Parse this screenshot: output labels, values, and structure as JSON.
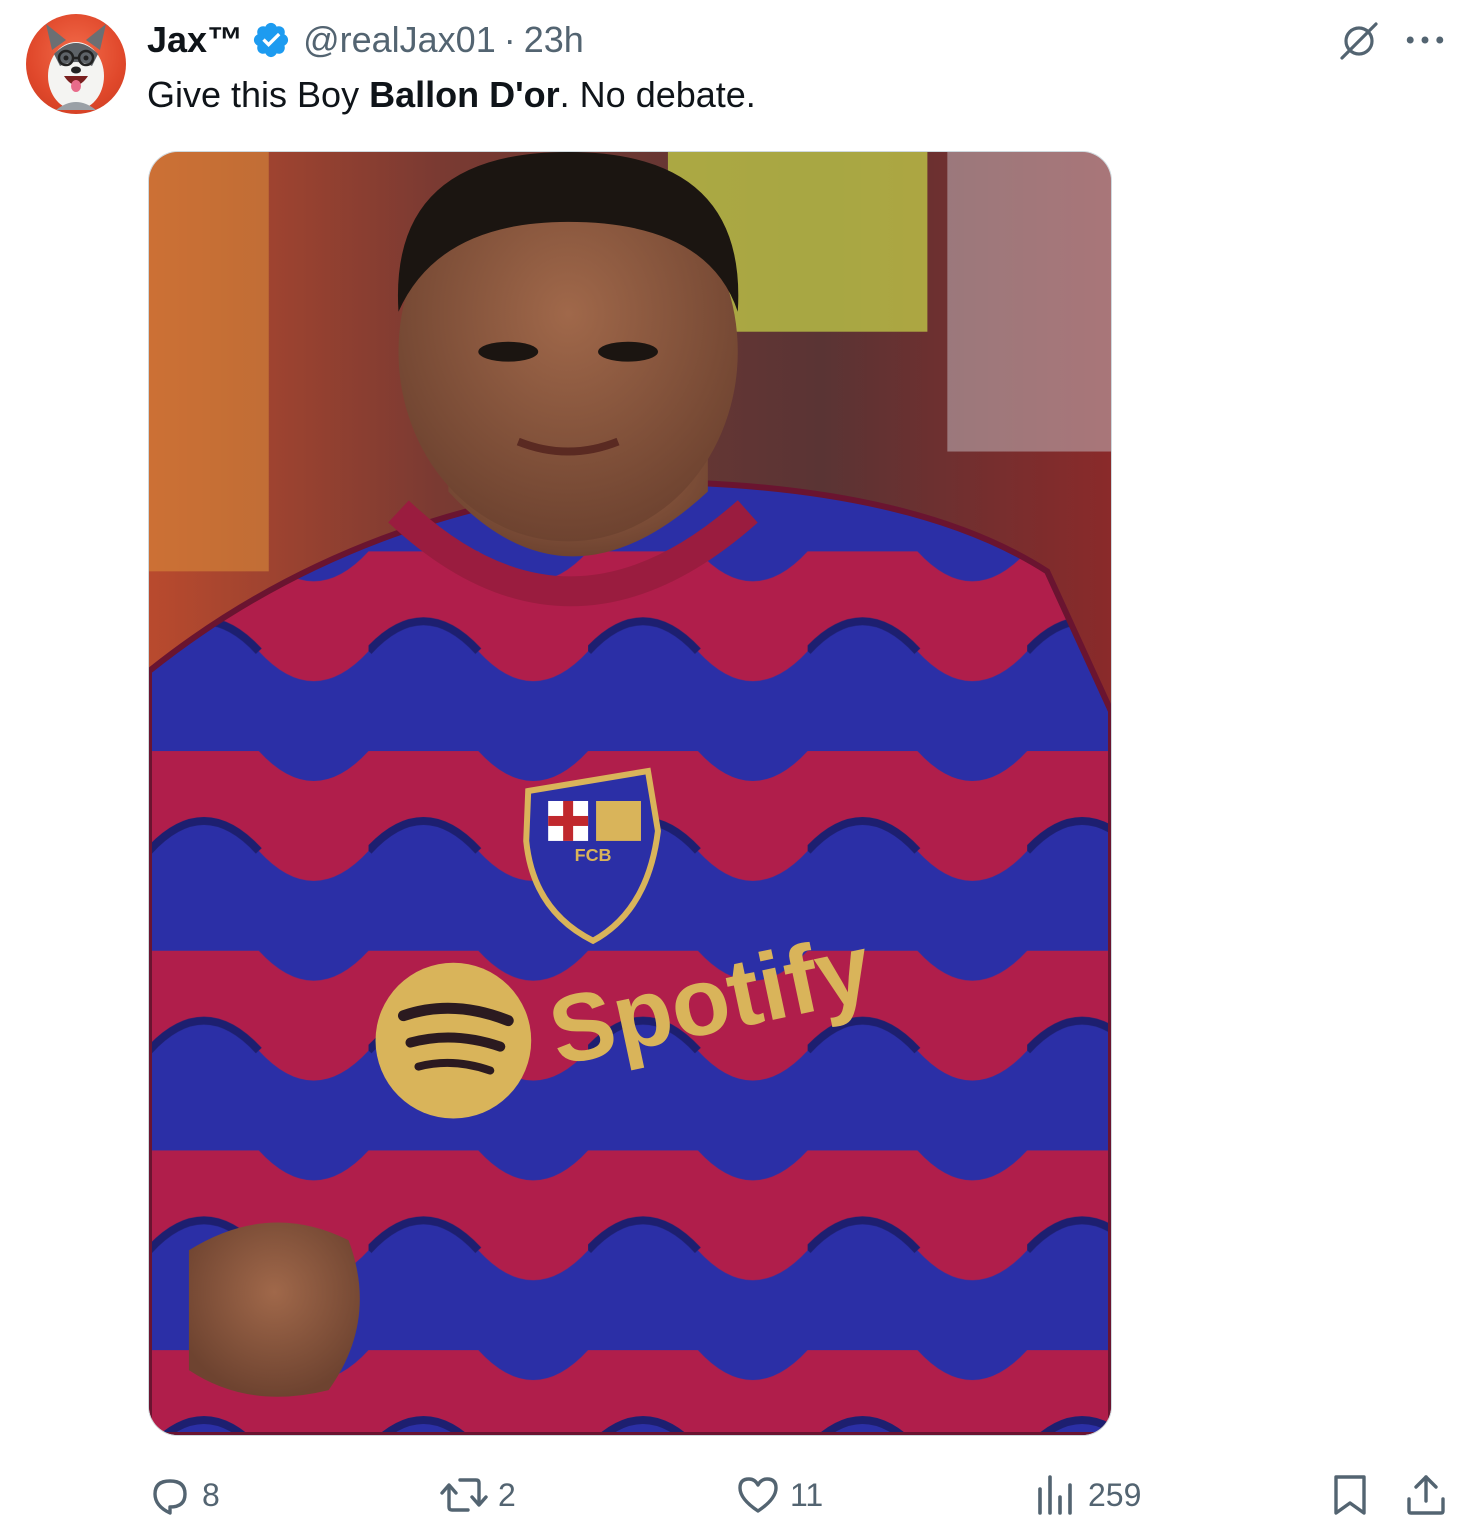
{
  "author": {
    "name": "Jax™",
    "handle": "@realJax01",
    "separator": "·",
    "time": "23h",
    "verified": true,
    "avatar_icon": "husky-dog-avatar-icon"
  },
  "tweet": {
    "text_before": "Give this Boy ",
    "text_bold": "Ballon D'or",
    "text_after": ". No debate."
  },
  "media": {
    "jersey_sponsor": "Spotify",
    "crest_text": "FCB"
  },
  "actions": {
    "replies": "8",
    "reposts": "2",
    "likes": "11",
    "views": "259"
  },
  "colors": {
    "verified_blue": "#1d9bf0",
    "icon_gray": "#536471",
    "text": "#0f1419",
    "jersey_red": "#b01e4b",
    "jersey_blue": "#2b2fa6",
    "sponsor_gold": "#d9b45a"
  }
}
